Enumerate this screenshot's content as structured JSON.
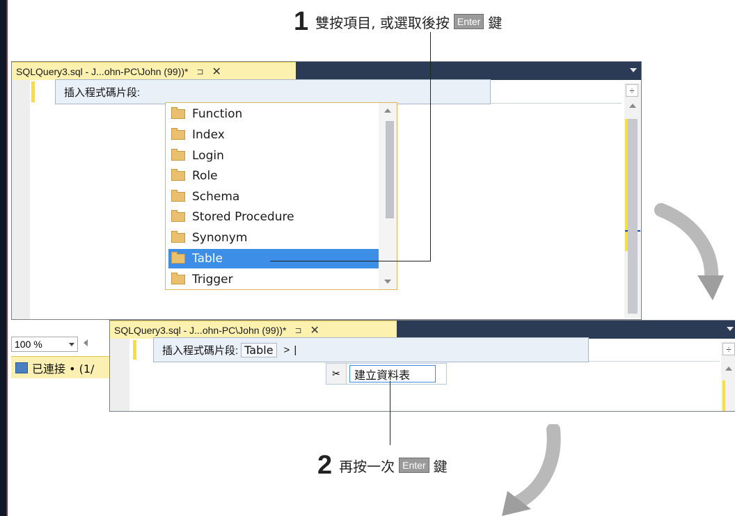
{
  "step1": {
    "number": "1",
    "text": "雙按項目, 或選取後按",
    "key": "Enter",
    "suffix": "鍵"
  },
  "step2": {
    "number": "2",
    "text": "再按一次",
    "key": "Enter",
    "suffix": "鍵"
  },
  "window1": {
    "tab_title": "SQLQuery3.sql - J...ohn-PC\\John (99))*",
    "pin_icon": "⊐",
    "close_icon": "✕",
    "snippet_prompt": "插入程式碼片段:",
    "list_items": [
      "Function",
      "Index",
      "Login",
      "Role",
      "Schema",
      "Stored Procedure",
      "Synonym",
      "Table",
      "Trigger"
    ],
    "selected_item": "Table"
  },
  "statusbar": {
    "zoom": "100 %",
    "connected": "已連接 • (1/"
  },
  "window2": {
    "tab_title": "SQLQuery3.sql - J...ohn-PC\\John (99))*",
    "snippet_prompt": "插入程式碼片段:",
    "path_chip": "Table",
    "separator": ">",
    "cursor": "|",
    "suggestion": "建立資料表"
  },
  "colors": {
    "accent_selection": "#3c8ee6",
    "tab_active": "#fdf1b0",
    "tabbar": "#2b3a55",
    "dropdown_border": "#e0b25a"
  }
}
